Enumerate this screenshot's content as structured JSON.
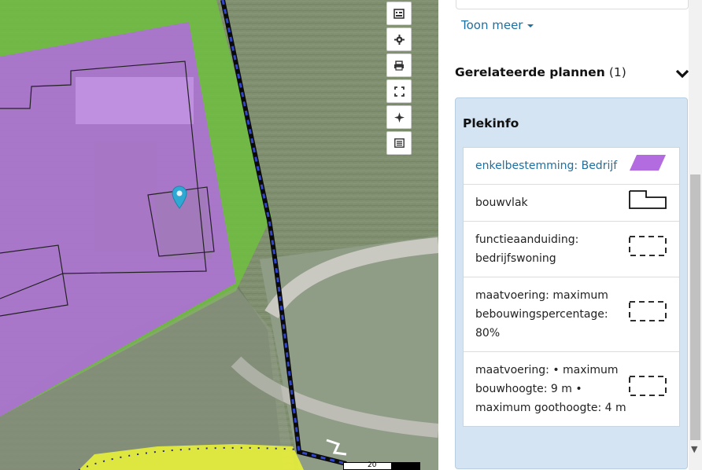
{
  "map": {
    "toolbar": [
      {
        "name": "legend-icon"
      },
      {
        "name": "settings-icon"
      },
      {
        "name": "print-icon"
      },
      {
        "name": "fullscreen-icon"
      },
      {
        "name": "locate-icon"
      },
      {
        "name": "list-icon"
      }
    ],
    "scale_label": "20"
  },
  "panel": {
    "show_more": "Toon meer",
    "related": {
      "title": "Gerelateerde plannen",
      "count": "(1)"
    },
    "plekinfo": {
      "title": "Plekinfo",
      "items": [
        {
          "label": "enkelbestemming: Bedrijf",
          "symbol": "purple-parallelogram",
          "link": true
        },
        {
          "label": "bouwvlak",
          "symbol": "building-outline",
          "link": false
        },
        {
          "label": "functieaanduiding: bedrijfswoning",
          "symbol": "dashed-rect",
          "link": false
        },
        {
          "label": "maatvoering: maximum bebouwingspercentage: 80%",
          "symbol": "dashed-rect",
          "link": false
        },
        {
          "label": "maatvoering: • maximum bouwhoogte: 9 m • maximum goothoogte: 4 m",
          "symbol": "dashed-rect",
          "link": false
        }
      ]
    }
  },
  "colors": {
    "bedrijf_purple": "#b36be0",
    "agrarisch_green": "#74b84a",
    "yellow_zone": "#e8ef3a",
    "link_blue": "#1f6f9f",
    "panel_blue": "#d4e4f3"
  }
}
